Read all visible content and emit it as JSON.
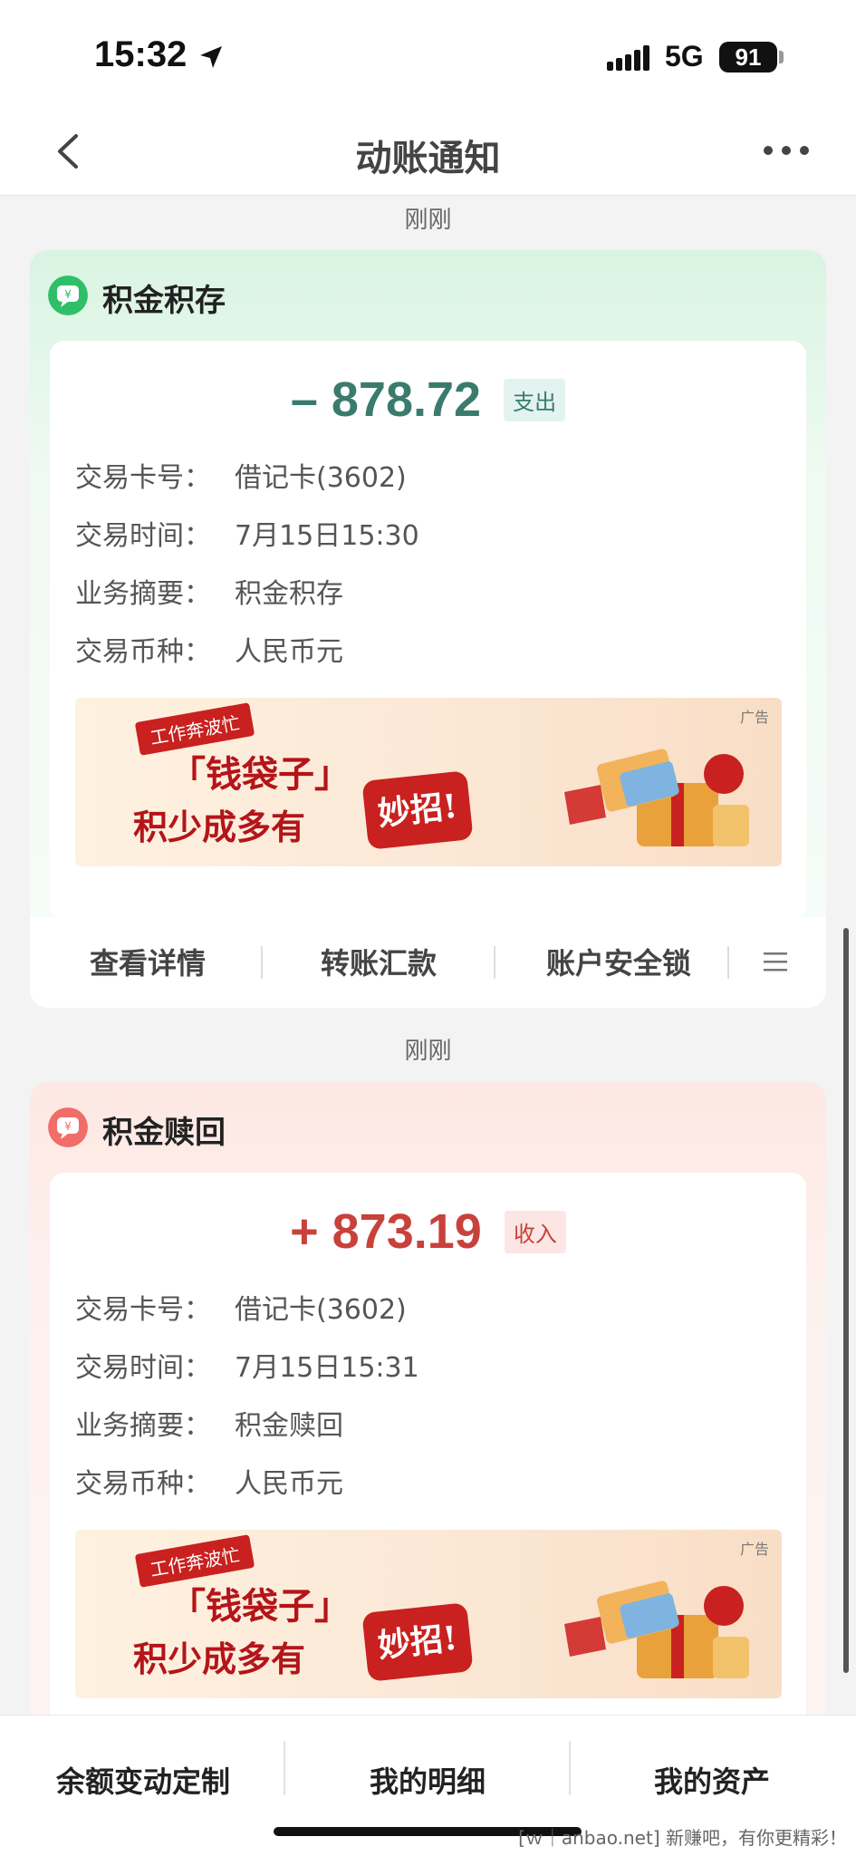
{
  "status": {
    "time": "15:32",
    "network": "5G",
    "battery": "91"
  },
  "nav": {
    "title": "动账通知"
  },
  "cards": [
    {
      "time_label": "刚刚",
      "title": "积金积存",
      "amount": "– 878.72",
      "tag": "支出",
      "rows": [
        {
          "k": "交易卡号：",
          "v": "借记卡(3602)"
        },
        {
          "k": "交易时间：",
          "v": "7月15日15:30"
        },
        {
          "k": "业务摘要：",
          "v": "积金积存"
        },
        {
          "k": "交易币种：",
          "v": "人民币元"
        }
      ],
      "ad": {
        "label": "广告",
        "banner": "工作奔波忙",
        "line1": "「钱袋子」",
        "line2": "积少成多有",
        "badge": "妙招!"
      },
      "actions": [
        "查看详情",
        "转账汇款",
        "账户安全锁"
      ]
    },
    {
      "time_label": "刚刚",
      "title": "积金赎回",
      "amount": "+ 873.19",
      "tag": "收入",
      "rows": [
        {
          "k": "交易卡号：",
          "v": "借记卡(3602)"
        },
        {
          "k": "交易时间：",
          "v": "7月15日15:31"
        },
        {
          "k": "业务摘要：",
          "v": "积金赎回"
        },
        {
          "k": "交易币种：",
          "v": "人民币元"
        }
      ],
      "ad": {
        "label": "广告",
        "banner": "工作奔波忙",
        "line1": "「钱袋子」",
        "line2": "积少成多有",
        "badge": "妙招!"
      }
    }
  ],
  "bottom": {
    "items": [
      "余额变动定制",
      "我的明细",
      "我的资产"
    ]
  },
  "watermark": "[ｗ｜anbao.net] 新赚吧，有你更精彩！",
  "colors": {
    "expense": "#3a7b6e",
    "income": "#c8413b"
  }
}
